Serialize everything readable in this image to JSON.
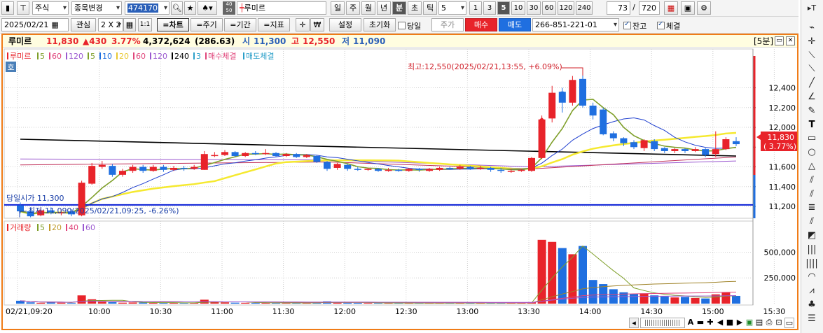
{
  "toolbar1": {
    "type_select": "주식",
    "change_button": "종목변경",
    "code_value": "474170",
    "name_value": "루미르",
    "mini_label_top": "40",
    "mini_label_bottom": "50",
    "periods": [
      "일",
      "주",
      "월",
      "년",
      "분",
      "초",
      "틱"
    ],
    "selected_period": "분",
    "interval_value": "5",
    "interval_buttons": [
      "1",
      "3",
      "5",
      "10",
      "30",
      "60",
      "120",
      "240"
    ],
    "selected_interval": "5",
    "count_value": "73",
    "total_separator": "/",
    "total_value": "720"
  },
  "toolbar2": {
    "date_value": "2025/02/21",
    "watch_label": "관심",
    "grid_label": "2 X 2",
    "ratio_label": "1:1",
    "tabs": [
      "=차트",
      "=주기",
      "=기간",
      "=지표"
    ],
    "active_tab": "=차트",
    "won_label": "₩",
    "settings_label": "설정",
    "reset_label": "초기화",
    "sameday_label": "당일",
    "price_label": "주가",
    "buy_label": "매수",
    "sell_label": "매도",
    "account_value": "266-851-221-01",
    "balance_label": "잔고",
    "balance_checked": true,
    "fill_label": "체결",
    "fill_checked": true
  },
  "info": {
    "name": "루미르",
    "price": "11,830",
    "change": "▲430",
    "change_pct": "3.77%",
    "volume": "4,372,624",
    "volume_pct": "(286.63)",
    "open_label": "시",
    "open": "11,300",
    "high_label": "고",
    "high": "12,550",
    "low_label": "저",
    "low": "11,090",
    "period_badge": "[5분]"
  },
  "colors": {
    "up": "#e8232a",
    "down": "#1f6fe0",
    "ma5": "#7f9f2a",
    "ma20": "#f5e92f",
    "ma60": "#9b59d0",
    "ma120": "#c0305a",
    "ma240": "#000000",
    "ma3": "#2a78c9",
    "blue_line": "#0a1fd6",
    "frame": "#f07c17"
  },
  "price_legend": [
    {
      "text": "루미르",
      "color": "#e8232a"
    },
    {
      "text": "5",
      "color": "#7f9f2a"
    },
    {
      "text": "60",
      "color": "#e0457b"
    },
    {
      "text": "120",
      "color": "#9b59d0"
    },
    {
      "text": "5",
      "color": "#7f9f2a"
    },
    {
      "text": "10",
      "color": "#1f6fe0"
    },
    {
      "text": "20",
      "color": "#e8c82f"
    },
    {
      "text": "60",
      "color": "#e0457b"
    },
    {
      "text": "120",
      "color": "#9b59d0"
    },
    {
      "text": "240",
      "color": "#000000"
    },
    {
      "text": "3",
      "color": "#2a9fc9"
    },
    {
      "text": "매수체결",
      "color": "#e0457b"
    },
    {
      "text": "매도체결",
      "color": "#2a9fc9"
    }
  ],
  "volume_legend": [
    {
      "text": "거래량",
      "color": "#e8232a"
    },
    {
      "text": "5",
      "color": "#7f9f2a"
    },
    {
      "text": "20",
      "color": "#c09a2a"
    },
    {
      "text": "40",
      "color": "#e0457b"
    },
    {
      "text": "60",
      "color": "#9b59d0"
    }
  ],
  "annotations": {
    "high": "최고:12,550(2025/02/21,13:55, +6.09%)",
    "low": "최저:11,090(2025/02/21,09:25, -6.26%)",
    "open_line": "당일시가 11,300",
    "current_price": "11,830",
    "current_pct": "( 3.77%)",
    "ho_badge": "호"
  },
  "chart_data": [
    {
      "type": "candlestick",
      "title": "",
      "x_ticks": [
        "02/21,09:20",
        "10:00",
        "10:30",
        "11:00",
        "11:30",
        "12:00",
        "12:30",
        "13:00",
        "13:30",
        "14:00",
        "14:30",
        "15:00",
        "15:30"
      ],
      "y_ticks": [
        "12,400",
        "12,200",
        "12,000",
        "11,800",
        "11,600",
        "11,400",
        "11,200"
      ],
      "ylim": [
        11080,
        12680
      ],
      "open_price": 11300,
      "candles": [
        {
          "t": "09:20",
          "o": 11210,
          "c": 11150,
          "h": 11240,
          "l": 11130
        },
        {
          "t": "09:25",
          "o": 11150,
          "c": 11100,
          "h": 11180,
          "l": 11090
        },
        {
          "t": "09:30",
          "o": 11110,
          "c": 11160,
          "h": 11190,
          "l": 11100
        },
        {
          "t": "09:35",
          "o": 11160,
          "c": 11140,
          "h": 11190,
          "l": 11120
        },
        {
          "t": "09:40",
          "o": 11140,
          "c": 11140,
          "h": 11170,
          "l": 11110
        },
        {
          "t": "09:45",
          "o": 11150,
          "c": 11120,
          "h": 11170,
          "l": 11100
        },
        {
          "t": "09:50",
          "o": 11110,
          "c": 11440,
          "h": 11460,
          "l": 11100
        },
        {
          "t": "09:55",
          "o": 11430,
          "c": 11610,
          "h": 11640,
          "l": 11420
        },
        {
          "t": "10:00",
          "o": 11600,
          "c": 11620,
          "h": 11660,
          "l": 11580
        },
        {
          "t": "10:05",
          "o": 11610,
          "c": 11520,
          "h": 11630,
          "l": 11500
        },
        {
          "t": "10:10",
          "o": 11520,
          "c": 11560,
          "h": 11580,
          "l": 11500
        },
        {
          "t": "10:15",
          "o": 11560,
          "c": 11600,
          "h": 11620,
          "l": 11540
        },
        {
          "t": "10:20",
          "o": 11600,
          "c": 11560,
          "h": 11620,
          "l": 11540
        },
        {
          "t": "10:25",
          "o": 11560,
          "c": 11600,
          "h": 11620,
          "l": 11550
        },
        {
          "t": "10:30",
          "o": 11600,
          "c": 11570,
          "h": 11620,
          "l": 11550
        },
        {
          "t": "10:35",
          "o": 11570,
          "c": 11590,
          "h": 11610,
          "l": 11560
        },
        {
          "t": "10:40",
          "o": 11590,
          "c": 11580,
          "h": 11610,
          "l": 11560
        },
        {
          "t": "10:45",
          "o": 11580,
          "c": 11600,
          "h": 11620,
          "l": 11570
        },
        {
          "t": "10:50",
          "o": 11570,
          "c": 11730,
          "h": 11760,
          "l": 11570
        },
        {
          "t": "10:55",
          "o": 11720,
          "c": 11720,
          "h": 11750,
          "l": 11700
        },
        {
          "t": "11:00",
          "o": 11720,
          "c": 11750,
          "h": 11770,
          "l": 11710
        },
        {
          "t": "11:05",
          "o": 11750,
          "c": 11710,
          "h": 11760,
          "l": 11700
        },
        {
          "t": "11:10",
          "o": 11710,
          "c": 11740,
          "h": 11750,
          "l": 11700
        },
        {
          "t": "11:15",
          "o": 11740,
          "c": 11730,
          "h": 11760,
          "l": 11720
        },
        {
          "t": "11:20",
          "o": 11730,
          "c": 11740,
          "h": 11780,
          "l": 11720
        },
        {
          "t": "11:25",
          "o": 11740,
          "c": 11710,
          "h": 11750,
          "l": 11700
        },
        {
          "t": "11:30",
          "o": 11710,
          "c": 11730,
          "h": 11740,
          "l": 11700
        },
        {
          "t": "11:35",
          "o": 11730,
          "c": 11700,
          "h": 11740,
          "l": 11690
        },
        {
          "t": "11:40",
          "o": 11700,
          "c": 11720,
          "h": 11730,
          "l": 11690
        },
        {
          "t": "11:45",
          "o": 11710,
          "c": 11650,
          "h": 11720,
          "l": 11640
        },
        {
          "t": "11:50",
          "o": 11650,
          "c": 11580,
          "h": 11660,
          "l": 11560
        },
        {
          "t": "11:55",
          "o": 11590,
          "c": 11630,
          "h": 11640,
          "l": 11570
        },
        {
          "t": "12:00",
          "o": 11620,
          "c": 11580,
          "h": 11630,
          "l": 11560
        },
        {
          "t": "12:05",
          "o": 11580,
          "c": 11570,
          "h": 11600,
          "l": 11560
        },
        {
          "t": "12:10",
          "o": 11570,
          "c": 11580,
          "h": 11590,
          "l": 11560
        },
        {
          "t": "12:15",
          "o": 11580,
          "c": 11560,
          "h": 11590,
          "l": 11550
        },
        {
          "t": "12:20",
          "o": 11560,
          "c": 11570,
          "h": 11590,
          "l": 11550
        },
        {
          "t": "12:25",
          "o": 11570,
          "c": 11560,
          "h": 11580,
          "l": 11550
        },
        {
          "t": "12:30",
          "o": 11560,
          "c": 11580,
          "h": 11590,
          "l": 11550
        },
        {
          "t": "12:35",
          "o": 11580,
          "c": 11570,
          "h": 11590,
          "l": 11550
        },
        {
          "t": "12:40",
          "o": 11560,
          "c": 11580,
          "h": 11590,
          "l": 11550
        },
        {
          "t": "12:45",
          "o": 11570,
          "c": 11590,
          "h": 11600,
          "l": 11560
        },
        {
          "t": "12:50",
          "o": 11590,
          "c": 11580,
          "h": 11600,
          "l": 11570
        },
        {
          "t": "12:55",
          "o": 11580,
          "c": 11600,
          "h": 11620,
          "l": 11570
        },
        {
          "t": "13:00",
          "o": 11600,
          "c": 11580,
          "h": 11610,
          "l": 11570
        },
        {
          "t": "13:05",
          "o": 11580,
          "c": 11590,
          "h": 11610,
          "l": 11570
        },
        {
          "t": "13:10",
          "o": 11590,
          "c": 11570,
          "h": 11600,
          "l": 11550
        },
        {
          "t": "13:15",
          "o": 11570,
          "c": 11560,
          "h": 11590,
          "l": 11540
        },
        {
          "t": "13:20",
          "o": 11560,
          "c": 11560,
          "h": 11580,
          "l": 11540
        },
        {
          "t": "13:25",
          "o": 11560,
          "c": 11570,
          "h": 11580,
          "l": 11550
        },
        {
          "t": "13:30",
          "o": 11560,
          "c": 11690,
          "h": 11700,
          "l": 11550
        },
        {
          "t": "13:35",
          "o": 11690,
          "c": 12080,
          "h": 12120,
          "l": 11680
        },
        {
          "t": "13:40",
          "o": 12090,
          "c": 12350,
          "h": 12420,
          "l": 12050
        },
        {
          "t": "13:45",
          "o": 12360,
          "c": 12250,
          "h": 12400,
          "l": 12150
        },
        {
          "t": "13:50",
          "o": 12250,
          "c": 12480,
          "h": 12520,
          "l": 12220
        },
        {
          "t": "13:55",
          "o": 12490,
          "c": 12220,
          "h": 12550,
          "l": 12200
        },
        {
          "t": "14:00",
          "o": 12220,
          "c": 12120,
          "h": 12250,
          "l": 12080
        },
        {
          "t": "14:05",
          "o": 12180,
          "c": 11930,
          "h": 12200,
          "l": 11920
        },
        {
          "t": "14:10",
          "o": 11940,
          "c": 11890,
          "h": 11960,
          "l": 11860
        },
        {
          "t": "14:15",
          "o": 11890,
          "c": 11840,
          "h": 11900,
          "l": 11810
        },
        {
          "t": "14:20",
          "o": 11850,
          "c": 11800,
          "h": 11870,
          "l": 11780
        },
        {
          "t": "14:25",
          "o": 11790,
          "c": 11870,
          "h": 11880,
          "l": 11760
        },
        {
          "t": "14:30",
          "o": 11860,
          "c": 11780,
          "h": 11880,
          "l": 11760
        },
        {
          "t": "14:35",
          "o": 11790,
          "c": 11760,
          "h": 11800,
          "l": 11740
        },
        {
          "t": "14:40",
          "o": 11760,
          "c": 11780,
          "h": 11790,
          "l": 11740
        },
        {
          "t": "14:45",
          "o": 11780,
          "c": 11760,
          "h": 11790,
          "l": 11740
        },
        {
          "t": "14:50",
          "o": 11760,
          "c": 11780,
          "h": 11800,
          "l": 11750
        },
        {
          "t": "14:55",
          "o": 11780,
          "c": 11720,
          "h": 11790,
          "l": 11700
        },
        {
          "t": "15:00",
          "o": 11730,
          "c": 11780,
          "h": 11960,
          "l": 11700
        },
        {
          "t": "15:05",
          "o": 11780,
          "c": 11880,
          "h": 11900,
          "l": 11770
        },
        {
          "t": "15:10",
          "o": 11860,
          "c": 11830,
          "h": 11900,
          "l": 11810
        }
      ],
      "lines": [
        {
          "name": "240",
          "color": "#000000",
          "values": [
            [
              0,
              11880
            ],
            [
              70,
              11710
            ]
          ]
        },
        {
          "name": "120",
          "color": "#9b59d0",
          "values": [
            [
              0,
              11680
            ],
            [
              30,
              11670
            ],
            [
              50,
              11600
            ],
            [
              70,
              11660
            ]
          ]
        },
        {
          "name": "60",
          "color": "#c0305a",
          "values": [
            [
              0,
              11620
            ],
            [
              30,
              11650
            ],
            [
              50,
              11580
            ],
            [
              70,
              11700
            ]
          ]
        }
      ]
    },
    {
      "type": "bar",
      "title": "",
      "y_ticks": [
        "500,000",
        "250,000"
      ],
      "ylim": [
        0,
        680000
      ],
      "values": [
        28000,
        12000,
        8000,
        14000,
        9000,
        6000,
        80000,
        42000,
        18000,
        14000,
        9000,
        11000,
        10000,
        8000,
        9000,
        7000,
        6000,
        8000,
        38000,
        16000,
        12000,
        9000,
        8000,
        7000,
        9000,
        7000,
        6000,
        7000,
        6000,
        14000,
        22000,
        11000,
        9000,
        7000,
        6000,
        6000,
        5000,
        5000,
        6000,
        5000,
        5000,
        6000,
        5000,
        7000,
        6000,
        5000,
        6000,
        7000,
        5000,
        6000,
        14000,
        620000,
        600000,
        540000,
        480000,
        560000,
        230000,
        190000,
        140000,
        110000,
        95000,
        100000,
        80000,
        70000,
        60000,
        65000,
        55000,
        50000,
        90000,
        110000,
        75000
      ]
    }
  ]
}
